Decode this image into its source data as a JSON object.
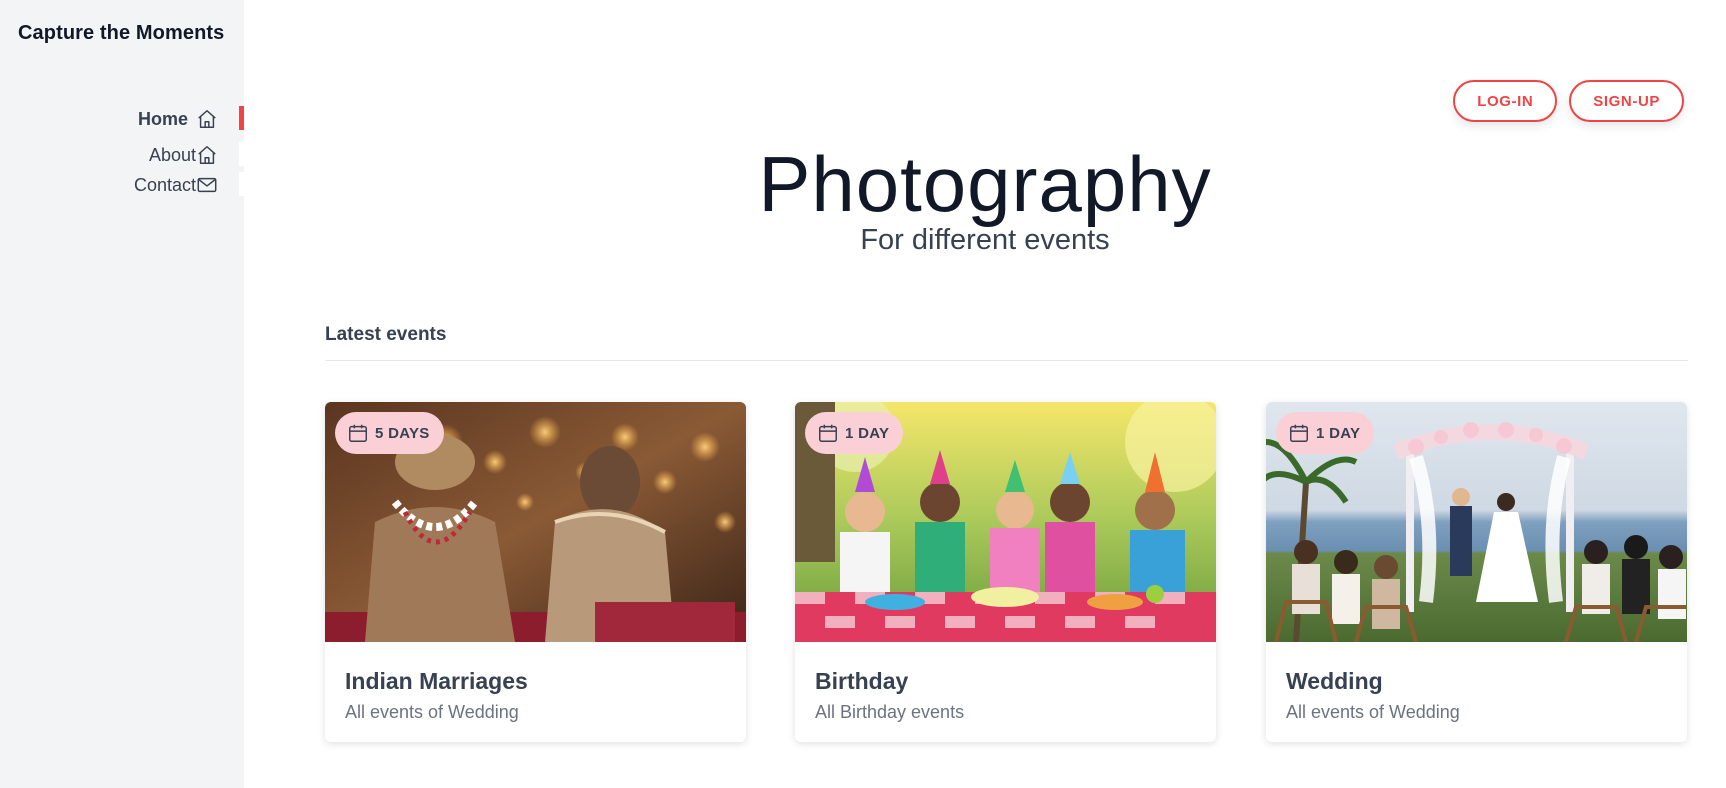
{
  "brand": "Capture the Moments",
  "nav": [
    {
      "label": "Home",
      "icon": "home-icon",
      "active": true
    },
    {
      "label": "About",
      "icon": "home-icon",
      "active": false
    },
    {
      "label": "Contact",
      "icon": "mail-icon",
      "active": false
    }
  ],
  "auth": {
    "login": "LOG-IN",
    "signup": "SIGN-UP"
  },
  "hero": {
    "title": "Photography",
    "subtitle": "For different events"
  },
  "section": {
    "title": "Latest events"
  },
  "cards": [
    {
      "badge": "5 DAYS",
      "title": "Indian Marriages",
      "subtitle": "All events of Wedding",
      "image": "indian-wedding-photo"
    },
    {
      "badge": "1 DAY",
      "title": "Birthday",
      "subtitle": "All Birthday events",
      "image": "birthday-party-photo"
    },
    {
      "badge": "1 DAY",
      "title": "Wedding",
      "subtitle": "All events of Wedding",
      "image": "outdoor-wedding-photo"
    }
  ],
  "colors": {
    "accent": "#ef4444",
    "badge_bg": "#fbcfd6",
    "sidebar_bg": "#f3f4f6"
  }
}
